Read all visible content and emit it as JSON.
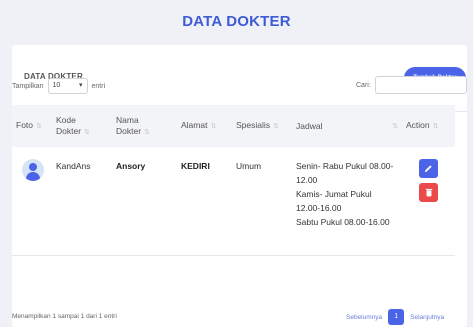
{
  "page": {
    "title": "DATA DOKTER"
  },
  "card": {
    "title": "DATA DOKTER",
    "add_button": "Tambah Dokter"
  },
  "controls": {
    "show_label": "Tampilkan",
    "show_value": "10",
    "entries_label": "entri",
    "search_label": "Cari:",
    "search_value": ""
  },
  "table": {
    "headers": [
      "Foto",
      "Kode Dokter",
      "Nama Dokter",
      "Alamat",
      "Spesialis",
      "Jadwal",
      "Action"
    ],
    "rows": [
      {
        "kode": "KandAns",
        "nama": "Ansory",
        "alamat": "KEDIRI",
        "spesialis": "Umum",
        "jadwal": [
          "Senin- Rabu Pukul 08.00-12.00",
          "Kamis- Jumat Pukul 12.00-16.00",
          "Sabtu Pukul 08.00-16.00"
        ]
      }
    ]
  },
  "footer": {
    "info": "Menampilkan 1 sampai 1 dari 1 entri",
    "prev": "Sebelumnya",
    "page": "1",
    "next": "Selanjutnya"
  },
  "colors": {
    "accent": "#4a63e7",
    "danger": "#ec4a4a",
    "title": "#3d5bd6"
  }
}
